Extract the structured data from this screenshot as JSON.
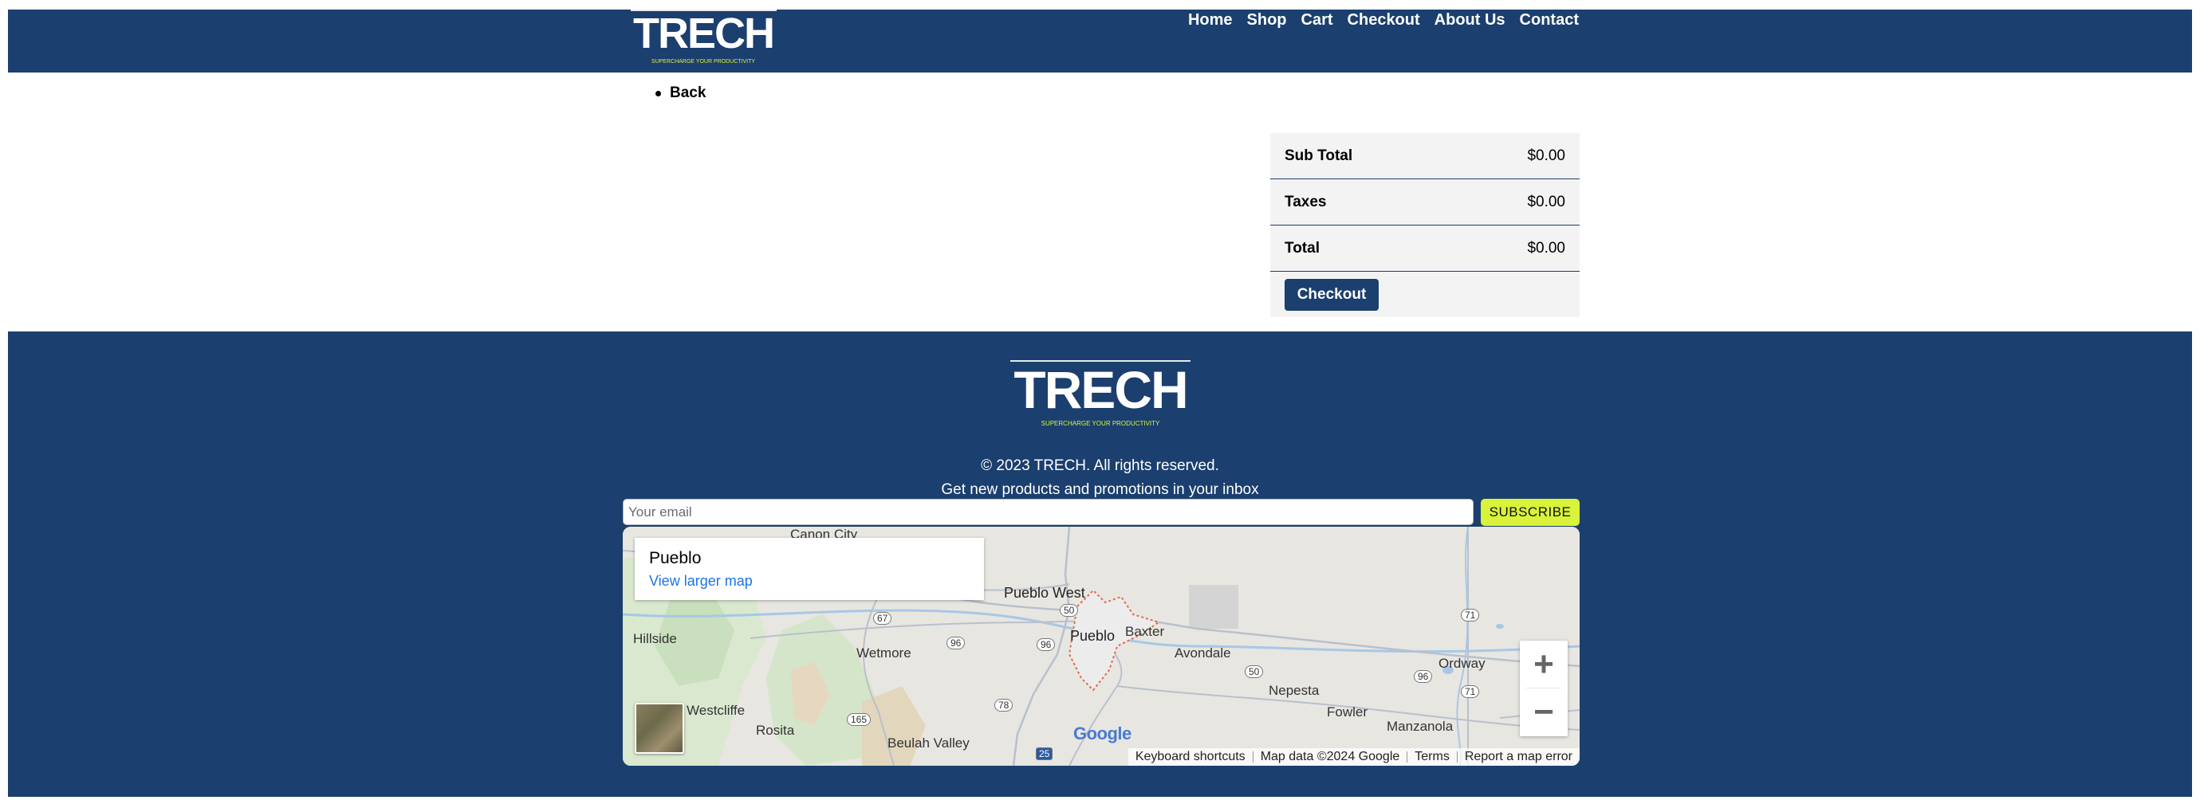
{
  "header": {
    "logo_alt": "TRECH",
    "nav": [
      "Home",
      "Shop",
      "Cart",
      "Checkout",
      "About Us",
      "Contact"
    ]
  },
  "breadcrumb": {
    "back_label": "Back"
  },
  "totals": {
    "rows": [
      {
        "label": "Sub Total",
        "value": "$0.00"
      },
      {
        "label": "Taxes",
        "value": "$0.00"
      },
      {
        "label": "Total",
        "value": "$0.00"
      }
    ],
    "checkout_label": "Checkout"
  },
  "footer": {
    "logo_alt": "TRECH",
    "logo_tagline": "SUPERCHARGE YOUR PRODUCTIVITY",
    "copyright": "© 2023 TRECH. All rights reserved.",
    "promo": "Get new products and promotions in your inbox",
    "email_placeholder": "Your email",
    "subscribe_label": "SUBSCRIBE"
  },
  "map": {
    "place_title": "Pueblo",
    "place_link": "View larger map",
    "labels": [
      "Canon City",
      "Pueblo West",
      "Pueblo",
      "Baxter",
      "Avondale",
      "Hillside",
      "Wetmore",
      "Westcliffe",
      "Rosita",
      "Beulah Valley",
      "Nepesta",
      "Fowler",
      "Manzanola",
      "Ordway"
    ],
    "route_shields": [
      "67",
      "50",
      "96",
      "96",
      "71",
      "50",
      "96",
      "71",
      "78",
      "165",
      "25"
    ],
    "google_mark": "Google",
    "attribution": [
      "Keyboard shortcuts",
      "Map data ©2024 Google",
      "Terms",
      "Report a map error"
    ],
    "zoom_in": "+",
    "zoom_out": "−"
  },
  "colors": {
    "brand_navy": "#1b3f6e",
    "accent_lime": "#d8f33a",
    "map_link": "#1a73e8"
  }
}
